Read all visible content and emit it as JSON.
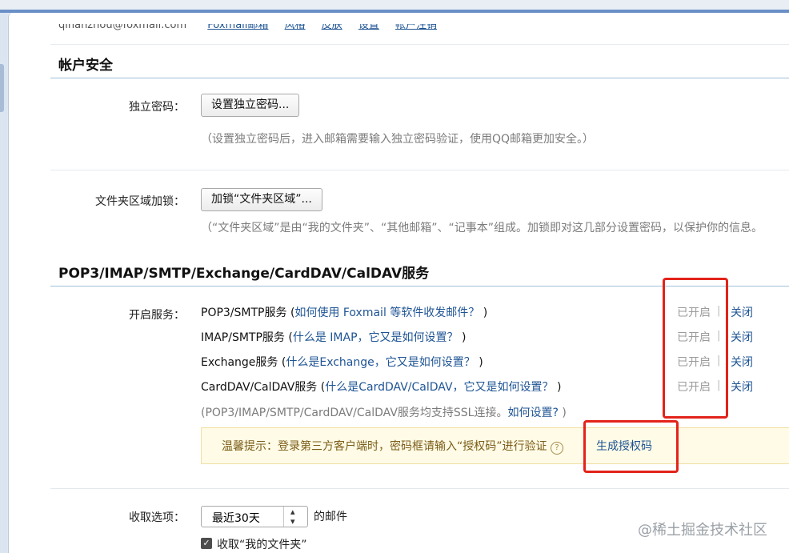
{
  "top_strip": {
    "email": "qinanzhou@foxmail.com",
    "links": [
      "Foxmail邮箱",
      "风格",
      "皮肤",
      "设置",
      "帐户注销"
    ]
  },
  "account_security": {
    "title": "帐户安全",
    "independent_password": {
      "label": "独立密码：",
      "button": "设置独立密码...",
      "hint": "（设置独立密码后，进入邮箱需要输入独立密码验证，使用QQ邮箱更加安全。）"
    },
    "folder_lock": {
      "label": "文件夹区域加锁：",
      "button": "加锁“文件夹区域”...",
      "hint": "（“文件夹区域”是由“我的文件夹”、“其他邮箱”、“记事本”组成。加锁即对这几部分设置密码，以保护你的信息。"
    }
  },
  "services": {
    "title": "POP3/IMAP/SMTP/Exchange/CardDAV/CalDAV服务",
    "enable_label": "开启服务：",
    "items": [
      {
        "name": "POP3/SMTP服务",
        "open": " (",
        "help": "如何使用 Foxmail 等软件收发邮件？",
        "close": " )",
        "status": "已开启",
        "sep": "|",
        "action": "关闭"
      },
      {
        "name": "IMAP/SMTP服务",
        "open": " (",
        "help": "什么是 IMAP，它又是如何设置？",
        "close": " )",
        "status": "已开启",
        "sep": "|",
        "action": "关闭"
      },
      {
        "name": "Exchange服务",
        "open": " (",
        "help": "什么是Exchange，它又是如何设置？",
        "close": " )",
        "status": "已开启",
        "sep": "|",
        "action": "关闭"
      },
      {
        "name": "CardDAV/CalDAV服务",
        "open": " (",
        "help": "什么是CardDAV/CalDAV，它又是如何设置？",
        "close": " )",
        "status": "已开启",
        "sep": "|",
        "action": "关闭"
      }
    ],
    "ssl_note": "(POP3/IMAP/SMTP/CardDAV/CalDAV服务均支持SSL连接。",
    "ssl_link": "如何设置?",
    "ssl_close": " )",
    "tip_text": "温馨提示：登录第三方客户端时，密码框请输入“授权码”进行验证",
    "tip_icon": "?",
    "auth_link": "生成授权码",
    "highlight_color": "#e3231a"
  },
  "receive": {
    "label": "收取选项：",
    "selected": "最近30天",
    "suffix": "的邮件",
    "checkbox_label": "收取“我的文件夹”",
    "checkbox_checked": true
  },
  "watermark": "@稀土掘金技术社区"
}
